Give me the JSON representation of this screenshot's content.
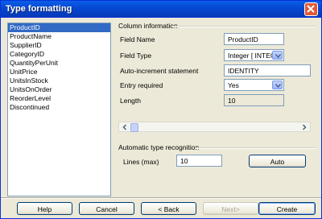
{
  "window": {
    "title": "Type formatting"
  },
  "fields_list": {
    "items": [
      "ProductID",
      "ProductName",
      "SupplierID",
      "CategoryID",
      "QuantityPerUnit",
      "UnitPrice",
      "UnitsInStock",
      "UnitsOnOrder",
      "ReorderLevel",
      "Discontinued"
    ],
    "selected": "ProductID"
  },
  "column_info": {
    "heading": "Column information",
    "field_name": {
      "label": "Field Name",
      "value": "ProductID"
    },
    "field_type": {
      "label": "Field Type",
      "value": "Integer [ INTEGE"
    },
    "auto_increment": {
      "label": "Auto-increment statement",
      "value": "IDENTITY"
    },
    "entry_required": {
      "label": "Entry required",
      "value": "Yes"
    },
    "length": {
      "label": "Length",
      "value": "10"
    }
  },
  "auto_recognition": {
    "heading": "Automatic type recognition",
    "lines_label": "Lines (max)",
    "lines_value": "10",
    "auto_button": "Auto"
  },
  "buttons": {
    "help": "Help",
    "cancel": "Cancel",
    "back": "< Back",
    "next": "Next>",
    "create": "Create"
  },
  "colors": {
    "selection": "#316ac5",
    "titlebar": "#0747d1",
    "dialog_bg": "#ece9d8",
    "close": "#e15a36"
  },
  "icons": {
    "close": "close-icon",
    "dropdown": "chevron-down-icon",
    "scroll_left": "arrow-left-icon",
    "scroll_right": "arrow-right-icon"
  }
}
